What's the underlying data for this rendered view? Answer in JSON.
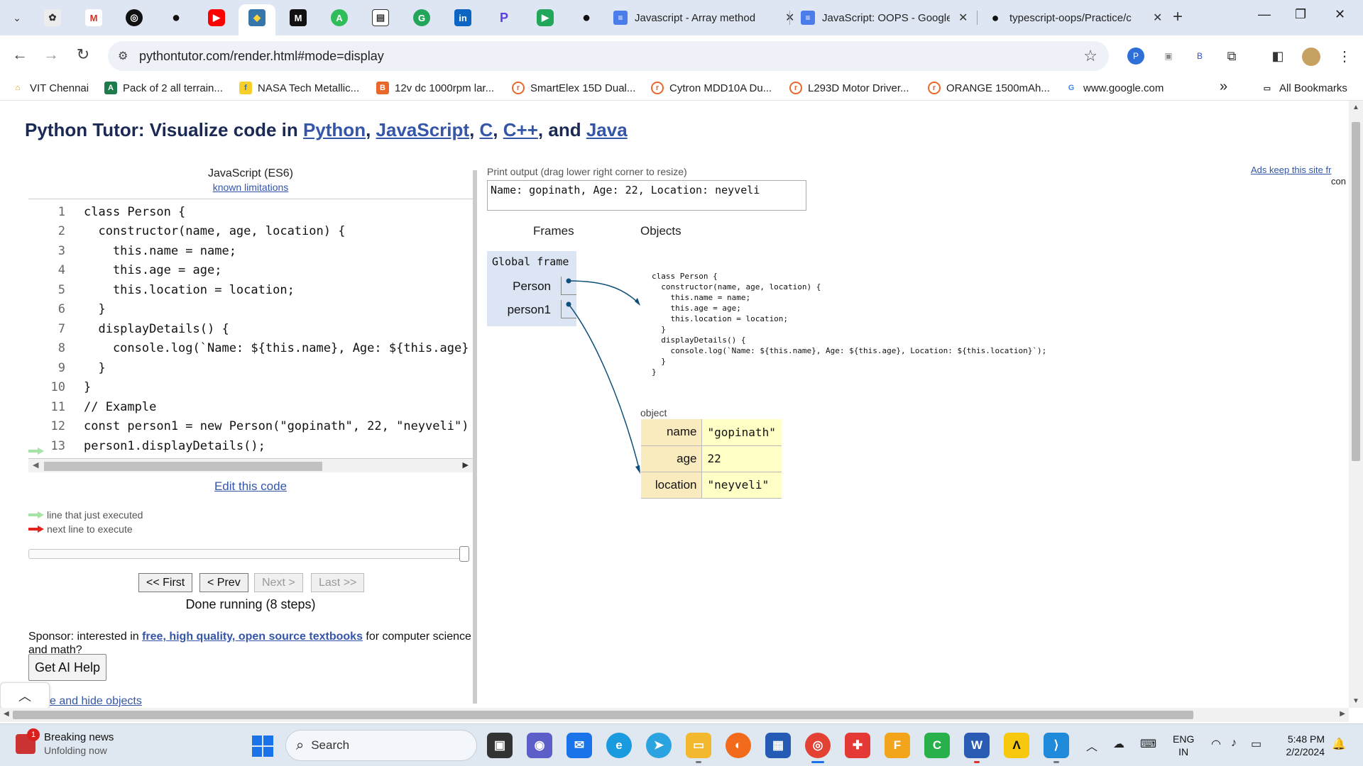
{
  "browser": {
    "tabs": [
      {
        "title": "Javascript - Array method"
      },
      {
        "title": "JavaScript: OOPS - Google"
      },
      {
        "title": "typescript-oops/Practice/c"
      }
    ],
    "url": "pythontutor.com/render.html#mode=display",
    "bookmarks": [
      "VIT Chennai",
      "Pack of 2 all terrain...",
      "NASA Tech Metallic...",
      "12v dc 1000rpm lar...",
      "SmartElex 15D Dual...",
      "Cytron MDD10A Du...",
      "L293D Motor Driver...",
      "ORANGE 1500mAh...",
      "www.google.com"
    ],
    "all_bookmarks": "All Bookmarks",
    "more_bookmarks": "»"
  },
  "page": {
    "title_prefix": "Python Tutor: Visualize code in ",
    "title_langs": [
      "Python",
      "JavaScript",
      "C",
      "C++",
      "Java"
    ],
    "sep1": ", ",
    "sep2": ", ",
    "sep3": ", ",
    "sep_and": ", and ",
    "ads_link": "Ads keep this site fr",
    "ads_sub": "con"
  },
  "editor": {
    "language": "JavaScript (ES6)",
    "limitations_link": "known limitations",
    "lines": [
      {
        "n": "1",
        "text": "class Person {"
      },
      {
        "n": "2",
        "text": "  constructor(name, age, location) {"
      },
      {
        "n": "3",
        "text": "    this.name = name;"
      },
      {
        "n": "4",
        "text": "    this.age = age;"
      },
      {
        "n": "5",
        "text": "    this.location = location;"
      },
      {
        "n": "6",
        "text": "  }"
      },
      {
        "n": "7",
        "text": "  displayDetails() {"
      },
      {
        "n": "8",
        "text": "    console.log(`Name: ${this.name}, Age: ${this.age}"
      },
      {
        "n": "9",
        "text": "  }"
      },
      {
        "n": "10",
        "text": "}"
      },
      {
        "n": "11",
        "text": "// Example"
      },
      {
        "n": "12",
        "text": "const person1 = new Person(\"gopinath\", 22, \"neyveli\")"
      },
      {
        "n": "13",
        "text": "person1.displayDetails();"
      }
    ],
    "edit_link": "Edit this code",
    "legend_executed": "line that just executed",
    "legend_next": "next line to execute"
  },
  "controls": {
    "first": "<< First",
    "prev": "< Prev",
    "next": "Next >",
    "last": "Last >>",
    "status": "Done running (8 steps)"
  },
  "sponsor": {
    "prefix": "Sponsor: interested in ",
    "link": "free, high quality, open source textbooks",
    "suffix": " for computer science and math?"
  },
  "ai_button": "Get AI Help",
  "hide_link": "e and hide objects",
  "visualization": {
    "output_label": "Print output (drag lower right corner to resize)",
    "output": "Name: gopinath, Age: 22, Location: neyveli",
    "frames_heading": "Frames",
    "objects_heading": "Objects",
    "global_frame": "Global frame",
    "variables": [
      "Person",
      "person1"
    ],
    "function_source": "class Person {\n  constructor(name, age, location) {\n    this.name = name;\n    this.age = age;\n    this.location = location;\n  }\n  displayDetails() {\n    console.log(`Name: ${this.name}, Age: ${this.age}, Location: ${this.location}`);\n  }\n}",
    "object_label": "object",
    "object_fields": [
      {
        "key": "name",
        "value": "\"gopinath\""
      },
      {
        "key": "age",
        "value": "22"
      },
      {
        "key": "location",
        "value": "\"neyveli\""
      }
    ]
  },
  "taskbar": {
    "news_title": "Breaking news",
    "news_sub": "Unfolding now",
    "news_badge": "1",
    "search": "Search",
    "lang_top": "ENG",
    "lang_bottom": "IN",
    "time": "5:48 PM",
    "date": "2/2/2024"
  }
}
